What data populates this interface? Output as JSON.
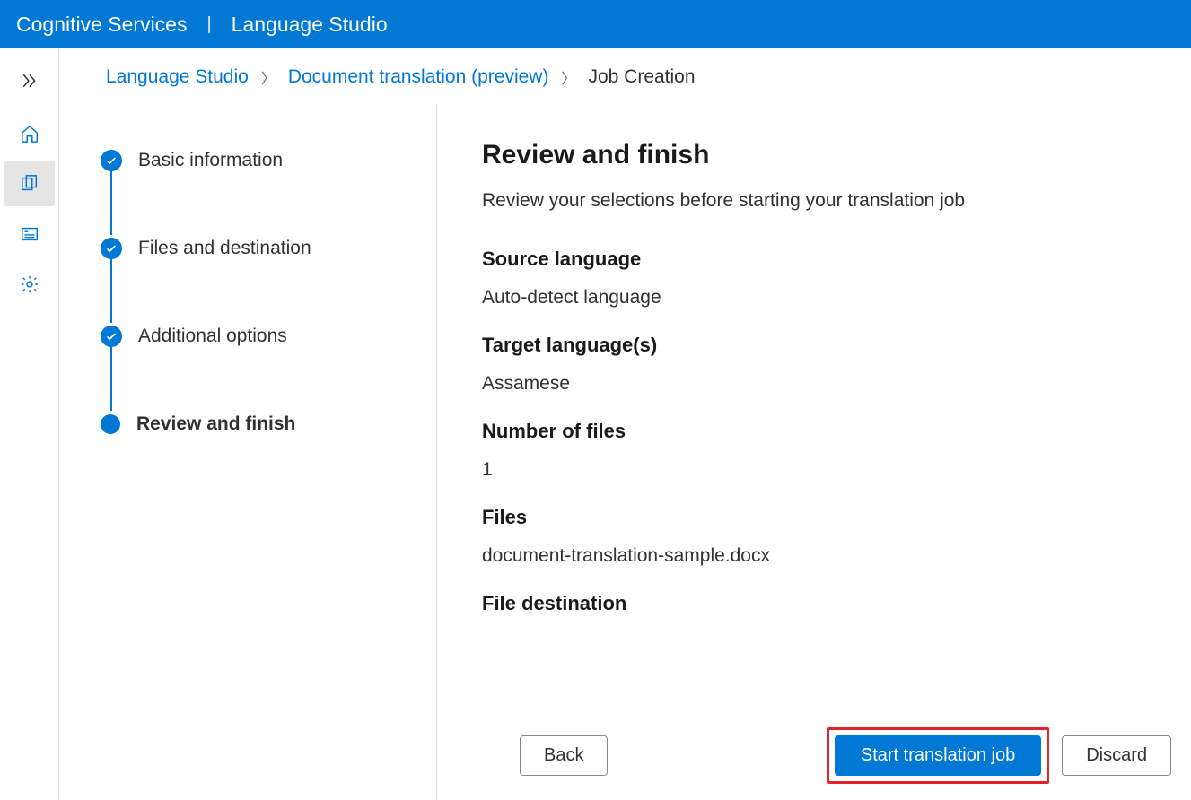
{
  "topbar": {
    "brand": "Cognitive Services",
    "product": "Language Studio"
  },
  "breadcrumb": {
    "items": [
      {
        "label": "Language Studio"
      },
      {
        "label": "Document translation (preview)"
      }
    ],
    "current": "Job Creation"
  },
  "stepper": {
    "steps": [
      {
        "label": "Basic information"
      },
      {
        "label": "Files and destination"
      },
      {
        "label": "Additional options"
      },
      {
        "label": "Review and finish"
      }
    ]
  },
  "review": {
    "title": "Review and finish",
    "subtitle": "Review your selections before starting your translation job",
    "fields": {
      "source_language": {
        "label": "Source language",
        "value": "Auto-detect language"
      },
      "target_languages": {
        "label": "Target language(s)",
        "value": "Assamese"
      },
      "number_of_files": {
        "label": "Number of files",
        "value": "1"
      },
      "files": {
        "label": "Files",
        "value": "document-translation-sample.docx"
      },
      "file_destination": {
        "label": "File destination",
        "value": ""
      }
    }
  },
  "footer": {
    "back": "Back",
    "start": "Start translation job",
    "discard": "Discard"
  }
}
